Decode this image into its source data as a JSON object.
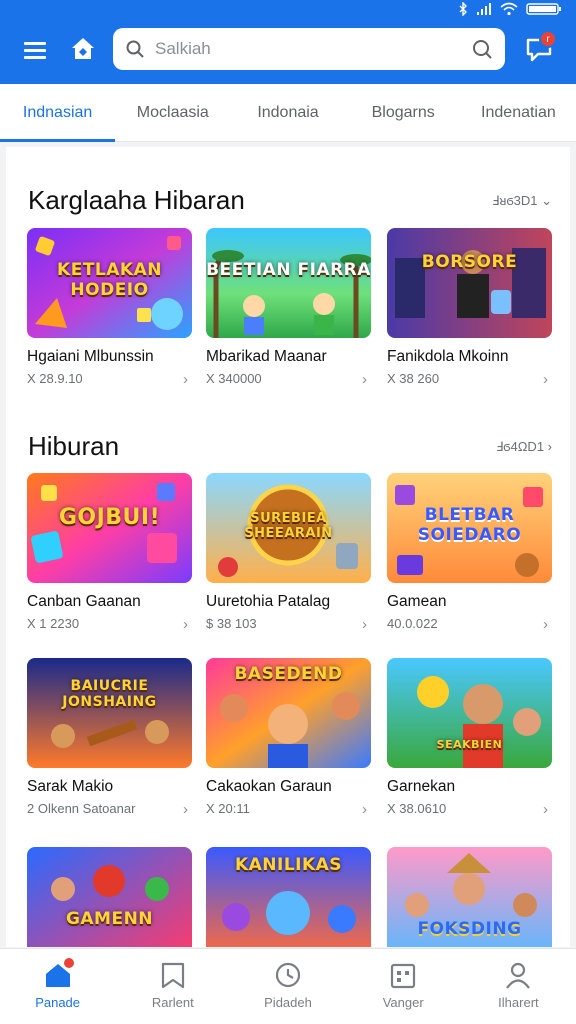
{
  "header": {
    "search_placeholder": "Salkiah",
    "notification_count": "r"
  },
  "tabs": [
    {
      "label": "Indnasian",
      "active": true
    },
    {
      "label": "Moclaasia",
      "active": false
    },
    {
      "label": "Indonaia",
      "active": false
    },
    {
      "label": "Blogarns",
      "active": false
    },
    {
      "label": "Indenatian",
      "active": false
    }
  ],
  "sections": [
    {
      "title": "Karglaaha Hibaran",
      "more": "Ⅎᴚϭ3D1 ⌄",
      "cards": [
        {
          "thumb_text": "KETLAKAN HODEIO",
          "name": "Hgaiani Mlbunssin",
          "sub": "X 28.9.10"
        },
        {
          "thumb_text": "BEETIAN FIARRA",
          "name": "Mbarikad Maanar",
          "sub": "X 340000"
        },
        {
          "thumb_text": "BORSORE",
          "name": "Fanikdola Mkoinn",
          "sub": "X 38 260"
        }
      ]
    },
    {
      "title": "Hiburan",
      "more": "Ⅎϭ4ΩD1 ›",
      "cards": [
        {
          "thumb_text": "GOJBUI!",
          "name": "Canban Gaanan",
          "sub": "X 1 2230"
        },
        {
          "thumb_text": "SUREBIEA SHEEARAIN",
          "name": "Uuretohia Patalag",
          "sub": "$ 38 103"
        },
        {
          "thumb_text": "BLETBAR SOIEDARO",
          "name": "Gamean",
          "sub": "40.0.022"
        }
      ]
    },
    {
      "title": "",
      "more": "",
      "cards": [
        {
          "thumb_text": "BAIUCRIE JONSHAING",
          "name": "Sarak Makio",
          "sub": "2 Olkenn Satoanar"
        },
        {
          "thumb_text": "BASEDEND",
          "name": "Cakaokan Garaun",
          "sub": "X 20:11"
        },
        {
          "thumb_text": "SEAKBIEN",
          "name": "Garnekan",
          "sub": "X 38.0610"
        }
      ]
    },
    {
      "title": "",
      "more": "",
      "cards": [
        {
          "thumb_text": "GAMENN",
          "name": "",
          "sub": ""
        },
        {
          "thumb_text": "KANILIKAS",
          "name": "",
          "sub": ""
        },
        {
          "thumb_text": "FOKSDING",
          "name": "",
          "sub": ""
        }
      ]
    }
  ],
  "bottom_nav": [
    {
      "label": "Panade",
      "icon": "home-icon",
      "active": true
    },
    {
      "label": "Rarlent",
      "icon": "bookmark-icon",
      "active": false
    },
    {
      "label": "Pidadeh",
      "icon": "clock-icon",
      "active": false
    },
    {
      "label": "Vanger",
      "icon": "calendar-icon",
      "active": false
    },
    {
      "label": "Ilharert",
      "icon": "user-icon",
      "active": false
    }
  ],
  "colors": {
    "primary": "#1a73e8",
    "badge": "#ea4335"
  }
}
